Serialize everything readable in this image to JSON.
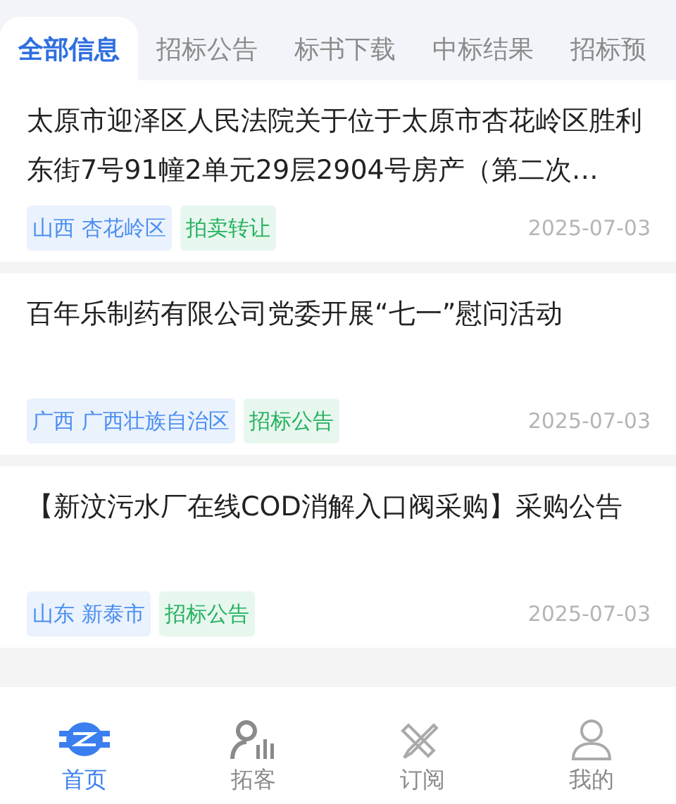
{
  "tabs": [
    {
      "label": "全部信息",
      "selected": true
    },
    {
      "label": "招标公告",
      "selected": false
    },
    {
      "label": "标书下载",
      "selected": false
    },
    {
      "label": "中标结果",
      "selected": false
    },
    {
      "label": "招标预",
      "selected": false
    }
  ],
  "items": [
    {
      "title": "太原市迎泽区人民法院关于位于太原市杏花岭区胜利东街7号91幢2单元29层2904号房产（第二次…",
      "tags": [
        {
          "kind": "region",
          "text": "山西 杏花岭区"
        },
        {
          "kind": "category",
          "text": "拍卖转让"
        }
      ],
      "date": "2025-07-03"
    },
    {
      "title": "百年乐制药有限公司党委开展“七一”慰问活动",
      "tags": [
        {
          "kind": "region",
          "text": "广西 广西壮族自治区"
        },
        {
          "kind": "category",
          "text": "招标公告"
        }
      ],
      "date": "2025-07-03"
    },
    {
      "title": "【新汶污水厂在线COD消解入口阀采购】采购公告",
      "tags": [
        {
          "kind": "region",
          "text": "山东 新泰市"
        },
        {
          "kind": "category",
          "text": "招标公告"
        }
      ],
      "date": "2025-07-03"
    }
  ],
  "nav": [
    {
      "kind": "home",
      "label": "首页",
      "selected": true
    },
    {
      "kind": "clients",
      "label": "拓客",
      "selected": false
    },
    {
      "kind": "subscribe",
      "label": "订阅",
      "selected": false
    },
    {
      "kind": "profile",
      "label": "我的",
      "selected": false
    }
  ]
}
